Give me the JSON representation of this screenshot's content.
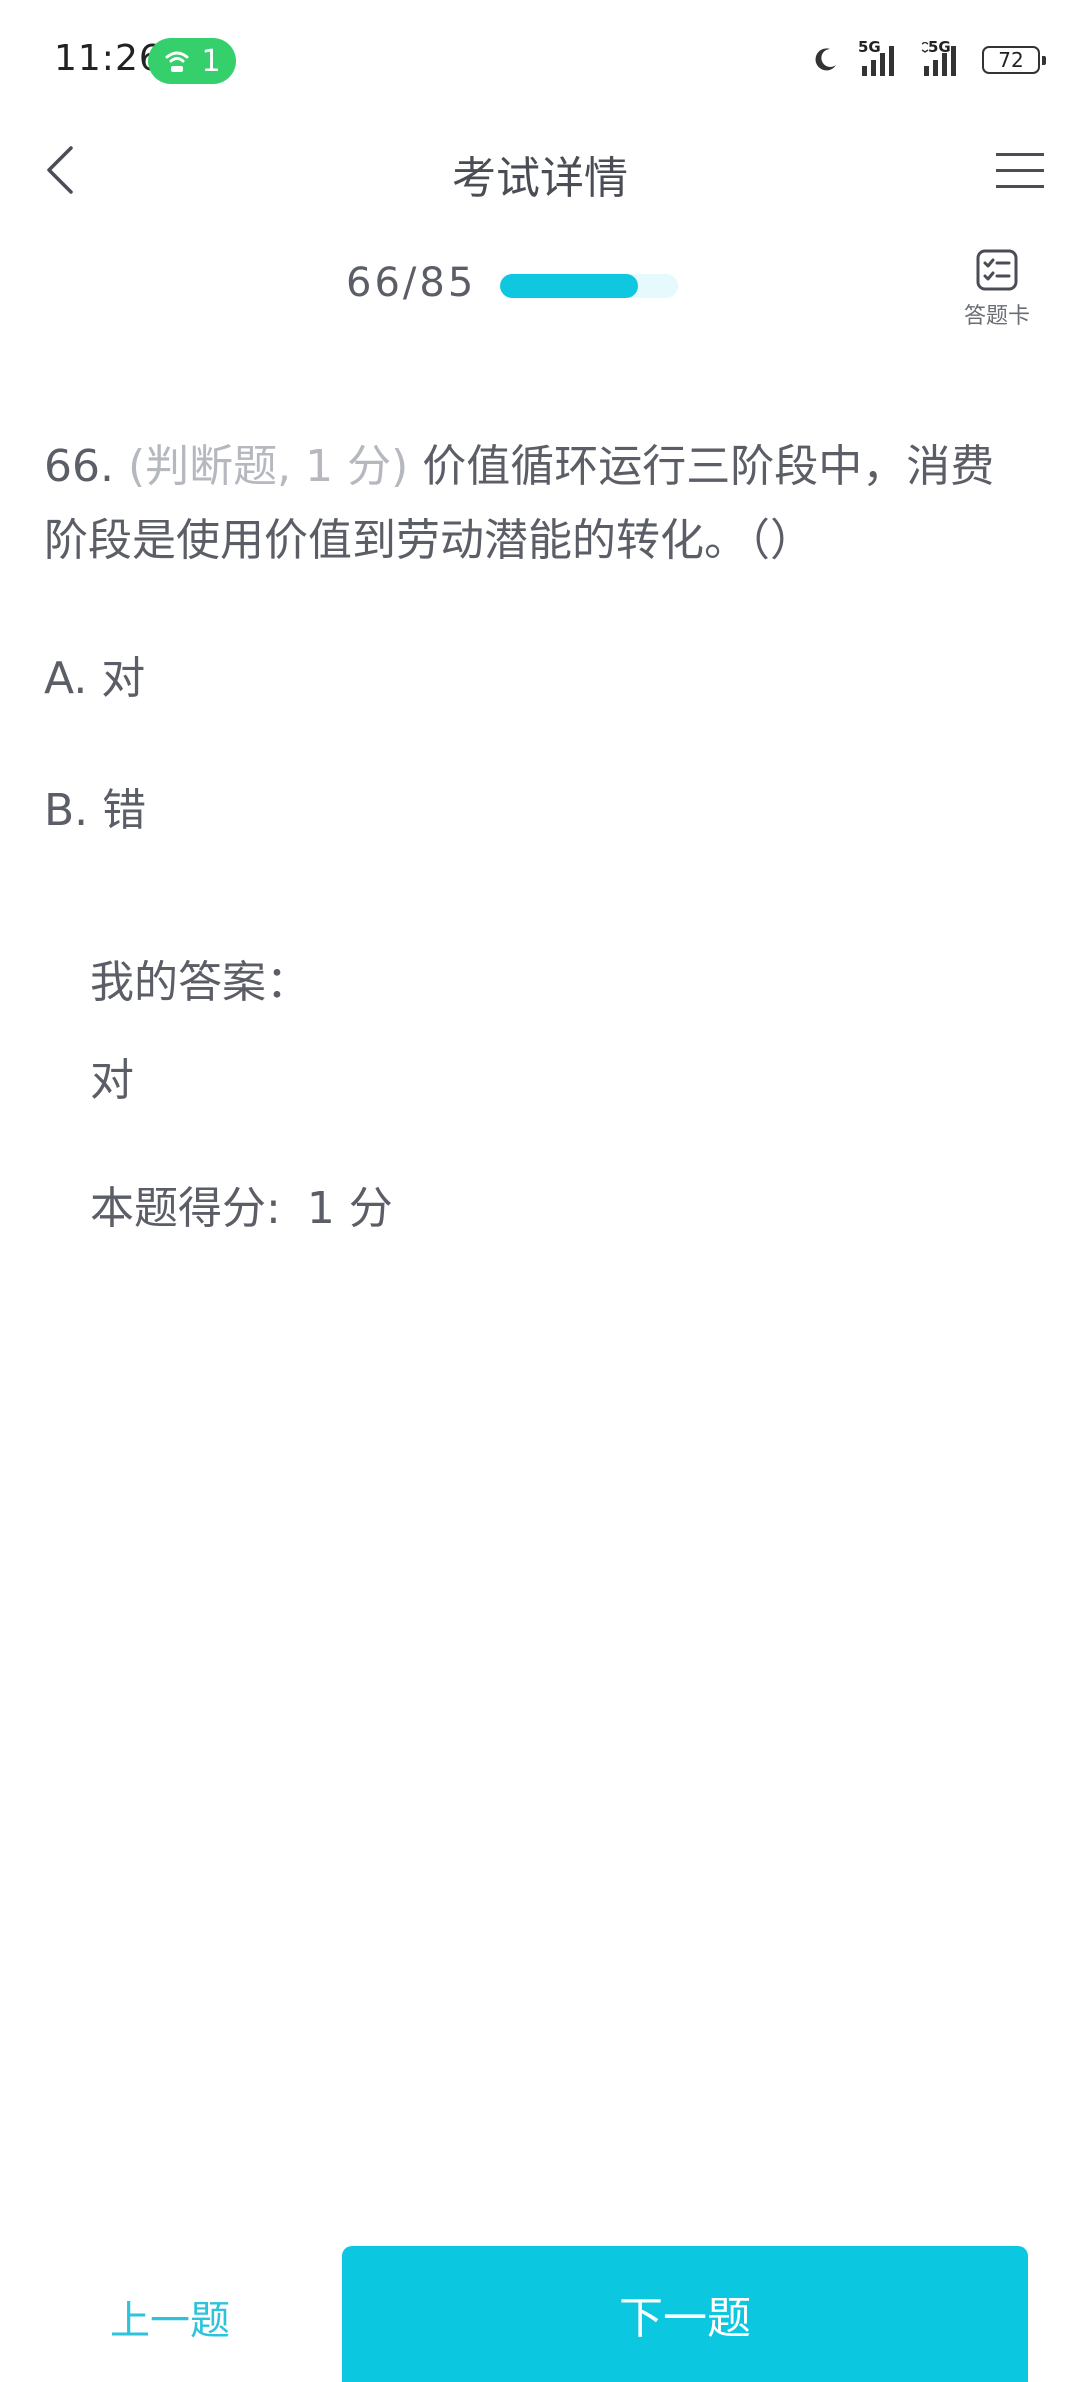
{
  "status_bar": {
    "time": "11:26",
    "hotspot_count": "1",
    "signal_1_label": "5G",
    "signal_2_label": "5G",
    "battery": "72"
  },
  "nav": {
    "title": "考试详情"
  },
  "progress": {
    "text": "66/85",
    "fraction": 0.7765
  },
  "answer_card": {
    "label": "答题卡"
  },
  "question": {
    "number": "66.",
    "type": "(判断题, 1 分)",
    "text": "价值循环运行三阶段中，消费阶段是使用价值到劳动潜能的转化。（）"
  },
  "options": [
    {
      "label": "A. 对"
    },
    {
      "label": "B. 错"
    }
  ],
  "my_answer": {
    "label": "我的答案：",
    "value": "对"
  },
  "score": {
    "label": "本题得分:",
    "value": "1 分"
  },
  "bottom": {
    "prev_label": "上一题",
    "next_label": "下一题"
  },
  "colors": {
    "accent": "#0bc8e0",
    "text": "#5b5e66",
    "muted": "#b5b8bf",
    "hotspot": "#35d06c"
  }
}
